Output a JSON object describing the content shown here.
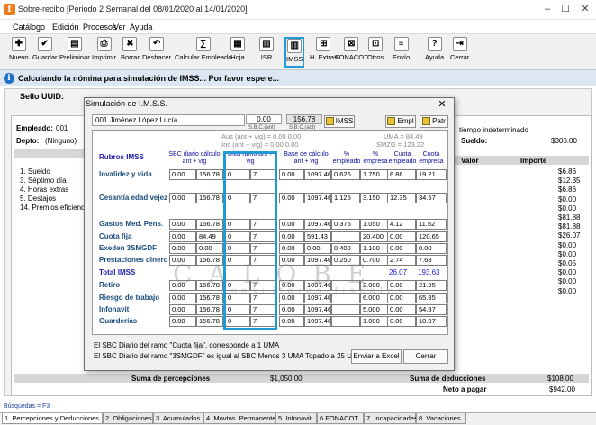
{
  "window": {
    "title": "Sobre-recibo  [Periodo 2 Semanal del 08/01/2020 al 14/01/2020]",
    "app_icon": "f"
  },
  "menu": [
    "Catálogo",
    "Edición",
    "Procesos",
    "Ver",
    "Ayuda"
  ],
  "toolbar": [
    {
      "label": "Nuevo",
      "icon": "new-icon",
      "glyph": "✚"
    },
    {
      "label": "Guardar",
      "icon": "save-icon",
      "glyph": "✔"
    },
    {
      "label": "Preliminar",
      "icon": "preview-icon",
      "glyph": "▤"
    },
    {
      "label": "Imprimir",
      "icon": "print-icon",
      "glyph": "⎙"
    },
    {
      "label": "Borrar",
      "icon": "delete-icon",
      "glyph": "✖"
    },
    {
      "label": "Deshacer",
      "icon": "undo-icon",
      "glyph": "↶"
    },
    {
      "label": "Calcular Empleado",
      "icon": "calculate-icon",
      "glyph": "∑"
    },
    {
      "label": "Hoja",
      "icon": "sheet-icon",
      "glyph": "▦"
    },
    {
      "label": "ISR",
      "icon": "isr-icon",
      "glyph": "▥"
    },
    {
      "label": "IMSS",
      "icon": "imss-icon",
      "glyph": "▥"
    },
    {
      "label": "H. Extras",
      "icon": "extra-hours-icon",
      "glyph": "⊞"
    },
    {
      "label": "FONACOT",
      "icon": "fonacot-icon",
      "glyph": "⊠"
    },
    {
      "label": "Otros",
      "icon": "others-icon",
      "glyph": "⊡"
    },
    {
      "label": "Envío",
      "icon": "send-icon",
      "glyph": "≡"
    },
    {
      "label": "Ayuda",
      "icon": "help-icon",
      "glyph": "?"
    },
    {
      "label": "Cerrar",
      "icon": "close-app-icon",
      "glyph": "⇥"
    }
  ],
  "info": {
    "text": "Calculando la nómina para simulación de IMSS... Por favor espere..."
  },
  "background": {
    "sello_label": "Sello UUID:",
    "empleado_label": "Empleado:",
    "empleado_value": "001",
    "depto_label": "Depto:",
    "depto_value": "(Ninguno)",
    "contract_text": "tiempo indeterminado",
    "sueldo_label": "Sueldo:",
    "sueldo_value": "$300.00",
    "valor_header": "Valor",
    "importe_header": "Importe",
    "perceptions": [
      "1. Sueldo",
      "3. Séptimo día",
      "4. Horas extras",
      "5. Destajos",
      "14. Premios eficiencia"
    ],
    "importes": [
      "$6.86",
      "$12.35",
      "$6.86",
      "$0.00",
      "$0.00",
      "$81.88",
      "$81.88",
      "$26.07",
      "$0.00",
      "$0.00",
      "$0.05",
      "$0.00",
      "$0.00",
      "$0.00"
    ],
    "suma_percepciones_label": "Suma de percepciones",
    "suma_percepciones_value": "$1,050.00",
    "suma_deducciones_label": "Suma de deducciones",
    "suma_deducciones_value": "$108.00",
    "neto_label": "Neto a pagar",
    "neto_value": "$942.00",
    "busquedas": "Búsquedas = F3"
  },
  "bottom_tabs": [
    "1. Percepciones y Deducciones",
    "2. Obligaciones",
    "3. Acumulados",
    "4. Movtos. Permanentes",
    "5. Infonavit",
    "6.FONACOT",
    "7. Incapacidades",
    "8. Vacaciones"
  ],
  "dialog": {
    "title": "Simulación de I.M.S.S.",
    "employee": "001  Jiménez López Lucía",
    "sbc_ant": "0.00",
    "sbc_ant_label": "S.B.C.(ant)",
    "sbc_act": "156.78",
    "sbc_act_label": "S.B.C.(act)",
    "imss_btn": "IMSS",
    "empl_btn": "Empl",
    "patr_btn": "Patr",
    "aus_text": "Aus (ant + vig) = 0.00 0.00",
    "inc_text": "Inc (ant + vig) = 0.00 0.00",
    "uma_text": "UMA = 84.49",
    "smzg_text": "SMZG = 123.22",
    "headers": {
      "rubros": "Rubros IMSS",
      "sbc": "SBC diario cálculo ant + vig",
      "dias": "Días ramo ant + vig",
      "base": "Base de cálculo ant + vig",
      "pct_emp": "% empleado",
      "pct_empresa": "% empresa",
      "cuota_emp": "Cuota empleado",
      "cuota_empresa": "Cuota empresa"
    },
    "rows": [
      {
        "name": "Invalidez y vida",
        "sbc_ant": "0.00",
        "sbc_vig": "156.78",
        "dias_ant": "0",
        "dias_vig": "7",
        "base_ant": "0.00",
        "base_vig": "1097.46",
        "pct_emp": "0.625",
        "pct_empresa": "1.750",
        "cuota_emp": "6.86",
        "cuota_empresa": "19.21"
      },
      {
        "name": "Cesantía edad vejez",
        "sbc_ant": "0.00",
        "sbc_vig": "156.78",
        "dias_ant": "0",
        "dias_vig": "7",
        "base_ant": "0.00",
        "base_vig": "1097.46",
        "pct_emp": "1.125",
        "pct_empresa": "3.150",
        "cuota_emp": "12.35",
        "cuota_empresa": "34.57"
      },
      {
        "name": "Gastos Med. Pens.",
        "sbc_ant": "0.00",
        "sbc_vig": "156.78",
        "dias_ant": "0",
        "dias_vig": "7",
        "base_ant": "0.00",
        "base_vig": "1097.46",
        "pct_emp": "0.375",
        "pct_empresa": "1.050",
        "cuota_emp": "4.12",
        "cuota_empresa": "11.52"
      },
      {
        "name": "Cuota fija",
        "sbc_ant": "0.00",
        "sbc_vig": "84.49",
        "dias_ant": "0",
        "dias_vig": "7",
        "base_ant": "0.00",
        "base_vig": "591.43",
        "pct_emp": "",
        "pct_empresa": "20.400",
        "cuota_emp": "0.00",
        "cuota_empresa": "120.65"
      },
      {
        "name": "Exeden 3SMGDF",
        "sbc_ant": "0.00",
        "sbc_vig": "0.00",
        "dias_ant": "0",
        "dias_vig": "7",
        "base_ant": "0.00",
        "base_vig": "0.00",
        "pct_emp": "0.400",
        "pct_empresa": "1.100",
        "cuota_emp": "0.00",
        "cuota_empresa": "0.00"
      },
      {
        "name": "Prestaciones dinero",
        "sbc_ant": "0.00",
        "sbc_vig": "156.78",
        "dias_ant": "0",
        "dias_vig": "7",
        "base_ant": "0.00",
        "base_vig": "1097.46",
        "pct_emp": "0.250",
        "pct_empresa": "0.700",
        "cuota_emp": "2.74",
        "cuota_empresa": "7.68"
      },
      {
        "name": "Retiro",
        "sbc_ant": "0.00",
        "sbc_vig": "156.78",
        "dias_ant": "0",
        "dias_vig": "7",
        "base_ant": "0.00",
        "base_vig": "1097.46",
        "pct_emp": "",
        "pct_empresa": "2.000",
        "cuota_emp": "0.00",
        "cuota_empresa": "21.95"
      },
      {
        "name": "Riesgo de trabajo",
        "sbc_ant": "0.00",
        "sbc_vig": "156.78",
        "dias_ant": "0",
        "dias_vig": "7",
        "base_ant": "0.00",
        "base_vig": "1097.46",
        "pct_emp": "",
        "pct_empresa": "6.000",
        "cuota_emp": "0.00",
        "cuota_empresa": "65.85"
      },
      {
        "name": "Infonavit",
        "sbc_ant": "0.00",
        "sbc_vig": "156.78",
        "dias_ant": "0",
        "dias_vig": "7",
        "base_ant": "0.00",
        "base_vig": "1097.46",
        "pct_emp": "",
        "pct_empresa": "5.000",
        "cuota_emp": "0.00",
        "cuota_empresa": "54.87"
      },
      {
        "name": "Guarderías",
        "sbc_ant": "0.00",
        "sbc_vig": "156.78",
        "dias_ant": "0",
        "dias_vig": "7",
        "base_ant": "0.00",
        "base_vig": "1097.46",
        "pct_emp": "",
        "pct_empresa": "1.000",
        "cuota_emp": "0.00",
        "cuota_empresa": "10.97"
      }
    ],
    "total_label": "Total IMSS",
    "total_emp": "26.07",
    "total_empresa": "193.63",
    "watermark": "CALOBE",
    "watermark_sub": "consultores fiscales",
    "note1": "El SBC Diario del ramo \"Cuota fija\", corresponde a 1 UMA",
    "note2": "El SBC Diario del ramo \"3SMGDF\" es igual al SBC Menos 3 UMA Topado a 25 UMA",
    "excel_btn": "Enviar a Excel",
    "cerrar_btn": "Cerrar"
  },
  "colors": {
    "accent": "#1f9ad6",
    "info_bar": "#dde7f3",
    "rubro_text": "#1b4d7d"
  }
}
